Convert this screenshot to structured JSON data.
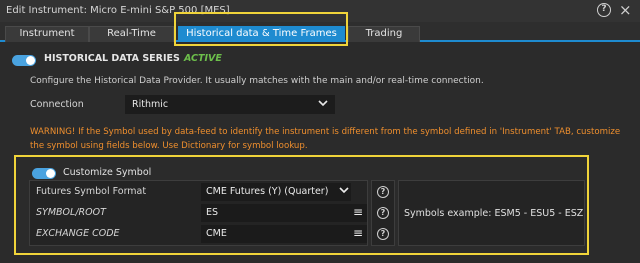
{
  "window": {
    "title": "Edit Instrument: Micro E-mini S&P 500 [MES]",
    "help_icon": "help-circle-icon",
    "close_icon": "close-icon",
    "close_glyph": "×"
  },
  "tabs": [
    {
      "label": "Instrument"
    },
    {
      "label": "Real-Time"
    },
    {
      "label": "Historical data & Time Frames"
    },
    {
      "label": "Trading"
    }
  ],
  "active_tab": "Historical data & Time Frames",
  "historical": {
    "section_label": "HISTORICAL DATA SERIES",
    "status": "ACTIVE",
    "description": "Configure the Historical Data Provider. It usually matches with the main and/or real-time connection.",
    "connection_label": "Connection",
    "connection_value": "Rithmic",
    "warning": "WARNING! If the Symbol used by data-feed to identify the instrument is different from the symbol defined in 'Instrument' TAB, customize the symbol using fields below. Use Dictionary for symbol lookup."
  },
  "customize": {
    "toggle_label": "Customize Symbol",
    "rows": [
      {
        "label": "Futures Symbol Format",
        "value": "CME Futures (Y) (Quarter)"
      },
      {
        "label": "SYMBOL/ROOT",
        "value": "ES"
      },
      {
        "label": "EXCHANGE CODE",
        "value": "CME"
      }
    ],
    "examples": "Symbols example: ESM5 - ESU5 - ESZ5"
  },
  "colors": {
    "accent": "#1e8bd0",
    "highlight": "#f0d43a",
    "warning": "#ef8f2e",
    "active": "#6dbf4b"
  }
}
